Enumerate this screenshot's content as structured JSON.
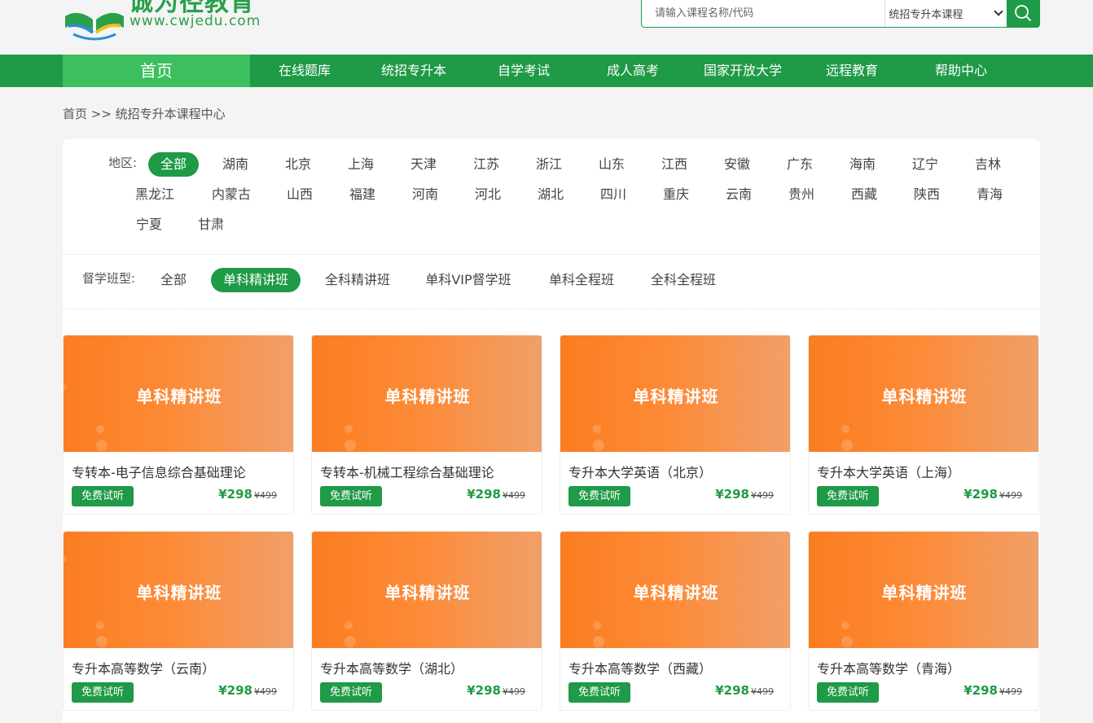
{
  "logo": {
    "cn": "诚为径教育",
    "en": "www.cwjedu.com"
  },
  "search": {
    "placeholder": "请输入课程名称/代码",
    "select_value": "统招专升本课程"
  },
  "nav": [
    "首页",
    "在线题库",
    "统招专升本",
    "自学考试",
    "成人高考",
    "国家开放大学",
    "远程教育",
    "帮助中心"
  ],
  "breadcrumb": "首页 >> 统招专升本课程中心",
  "filters": {
    "region_label": "地区:",
    "regions": [
      "全部",
      "湖南",
      "北京",
      "上海",
      "天津",
      "江苏",
      "浙江",
      "山东",
      "江西",
      "安徽",
      "广东",
      "海南",
      "辽宁",
      "吉林",
      "黑龙江",
      "内蒙古",
      "山西",
      "福建",
      "河南",
      "河北",
      "湖北",
      "四川",
      "重庆",
      "云南",
      "贵州",
      "西藏",
      "陕西",
      "青海",
      "宁夏",
      "甘肃"
    ],
    "region_selected": "全部",
    "class_label": "督学班型:",
    "class_types": [
      "全部",
      "单科精讲班",
      "全科精讲班",
      "单科VIP督学班",
      "单科全程班",
      "全科全程班"
    ],
    "class_selected": "单科精讲班"
  },
  "courses": [
    {
      "banner": "单科精讲班",
      "title": "专转本-电子信息综合基础理论",
      "trial": "免费试听",
      "price": "¥298",
      "old_price": "¥499"
    },
    {
      "banner": "单科精讲班",
      "title": "专转本-机械工程综合基础理论",
      "trial": "免费试听",
      "price": "¥298",
      "old_price": "¥499"
    },
    {
      "banner": "单科精讲班",
      "title": "专升本大学英语（北京）",
      "trial": "免费试听",
      "price": "¥298",
      "old_price": "¥499"
    },
    {
      "banner": "单科精讲班",
      "title": "专升本大学英语（上海）",
      "trial": "免费试听",
      "price": "¥298",
      "old_price": "¥499"
    },
    {
      "banner": "单科精讲班",
      "title": "专升本高等数学（云南）",
      "trial": "免费试听",
      "price": "¥298",
      "old_price": "¥499"
    },
    {
      "banner": "单科精讲班",
      "title": "专升本高等数学（湖北）",
      "trial": "免费试听",
      "price": "¥298",
      "old_price": "¥499"
    },
    {
      "banner": "单科精讲班",
      "title": "专升本高等数学（西藏）",
      "trial": "免费试听",
      "price": "¥298",
      "old_price": "¥499"
    },
    {
      "banner": "单科精讲班",
      "title": "专升本高等数学（青海）",
      "trial": "免费试听",
      "price": "¥298",
      "old_price": "¥499"
    }
  ],
  "colors": {
    "brand_green": "#1f9a46",
    "nav_active": "#3cbf5e",
    "banner_orange": "#fb7d21"
  },
  "icons": {
    "search": "search-icon",
    "logo": "book-logo-icon",
    "select": "chevron-down-icon"
  }
}
